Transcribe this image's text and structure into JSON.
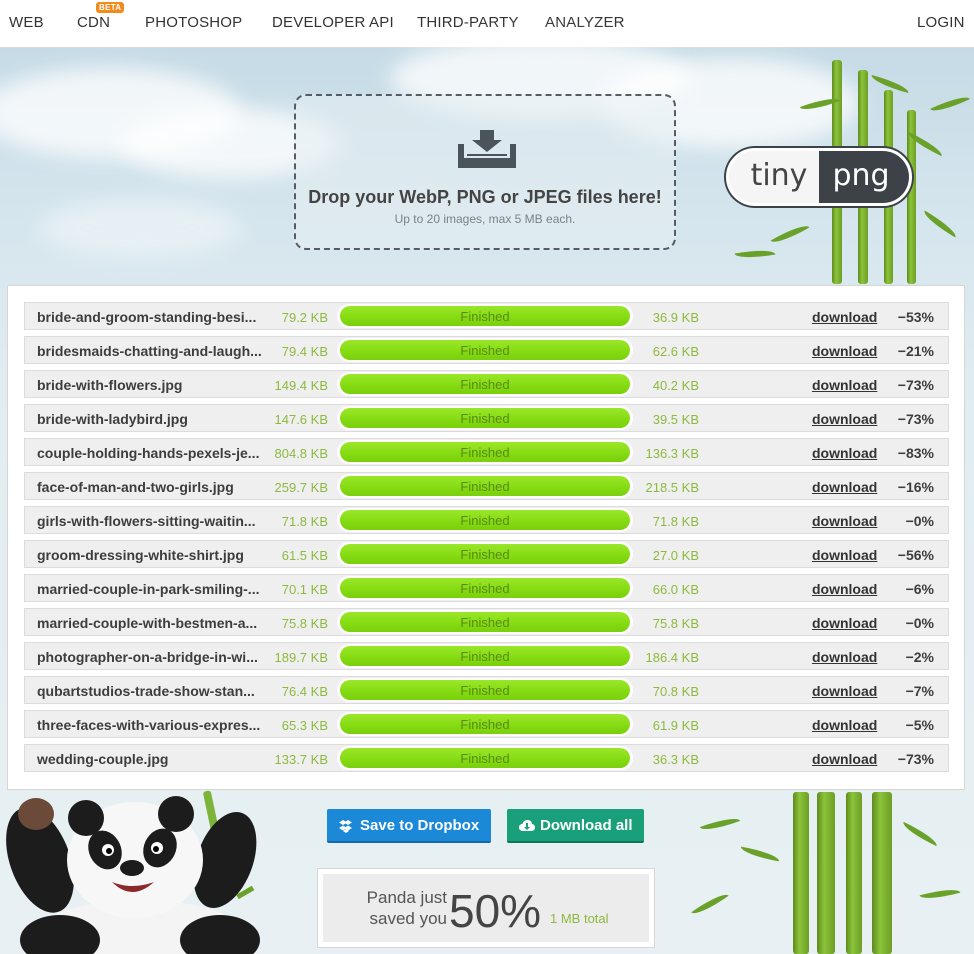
{
  "nav": {
    "items": [
      "WEB",
      "CDN",
      "PHOTOSHOP",
      "DEVELOPER API",
      "THIRD-PARTY",
      "ANALYZER"
    ],
    "badge": "BETA",
    "login": "LOGIN"
  },
  "dropzone": {
    "title": "Drop your WebP, PNG or JPEG files here!",
    "subtitle": "Up to 20 images, max 5 MB each."
  },
  "logo": {
    "left": "tiny",
    "right": "png"
  },
  "files": [
    {
      "name": "bride-and-groom-standing-besi...",
      "original": "79.2 KB",
      "status": "Finished",
      "new": "36.9 KB",
      "link": "download",
      "saving": "−53%"
    },
    {
      "name": "bridesmaids-chatting-and-laugh...",
      "original": "79.4 KB",
      "status": "Finished",
      "new": "62.6 KB",
      "link": "download",
      "saving": "−21%"
    },
    {
      "name": "bride-with-flowers.jpg",
      "original": "149.4 KB",
      "status": "Finished",
      "new": "40.2 KB",
      "link": "download",
      "saving": "−73%"
    },
    {
      "name": "bride-with-ladybird.jpg",
      "original": "147.6 KB",
      "status": "Finished",
      "new": "39.5 KB",
      "link": "download",
      "saving": "−73%"
    },
    {
      "name": "couple-holding-hands-pexels-je...",
      "original": "804.8 KB",
      "status": "Finished",
      "new": "136.3 KB",
      "link": "download",
      "saving": "−83%"
    },
    {
      "name": "face-of-man-and-two-girls.jpg",
      "original": "259.7 KB",
      "status": "Finished",
      "new": "218.5 KB",
      "link": "download",
      "saving": "−16%"
    },
    {
      "name": "girls-with-flowers-sitting-waitin...",
      "original": "71.8 KB",
      "status": "Finished",
      "new": "71.8 KB",
      "link": "download",
      "saving": "−0%"
    },
    {
      "name": "groom-dressing-white-shirt.jpg",
      "original": "61.5 KB",
      "status": "Finished",
      "new": "27.0 KB",
      "link": "download",
      "saving": "−56%"
    },
    {
      "name": "married-couple-in-park-smiling-...",
      "original": "70.1 KB",
      "status": "Finished",
      "new": "66.0 KB",
      "link": "download",
      "saving": "−6%"
    },
    {
      "name": "married-couple-with-bestmen-a...",
      "original": "75.8 KB",
      "status": "Finished",
      "new": "75.8 KB",
      "link": "download",
      "saving": "−0%"
    },
    {
      "name": "photographer-on-a-bridge-in-wi...",
      "original": "189.7 KB",
      "status": "Finished",
      "new": "186.4 KB",
      "link": "download",
      "saving": "−2%"
    },
    {
      "name": "qubartstudios-trade-show-stan...",
      "original": "76.4 KB",
      "status": "Finished",
      "new": "70.8 KB",
      "link": "download",
      "saving": "−7%"
    },
    {
      "name": "three-faces-with-various-expres...",
      "original": "65.3 KB",
      "status": "Finished",
      "new": "61.9 KB",
      "link": "download",
      "saving": "−5%"
    },
    {
      "name": "wedding-couple.jpg",
      "original": "133.7 KB",
      "status": "Finished",
      "new": "36.3 KB",
      "link": "download",
      "saving": "−73%"
    }
  ],
  "actions": {
    "dropbox": "Save to Dropbox",
    "download_all": "Download all"
  },
  "summary": {
    "line1": "Panda just",
    "line2": "saved you",
    "percent": "50%",
    "total": "1 MB total"
  },
  "colors": {
    "progress": "#86dc12",
    "size_text": "#8dba3e",
    "dropbox": "#1b89d8",
    "download_all": "#19a07a",
    "beta": "#f38b1c"
  },
  "icons": [
    "download-tray-icon",
    "dropbox-icon",
    "cloud-download-icon"
  ]
}
